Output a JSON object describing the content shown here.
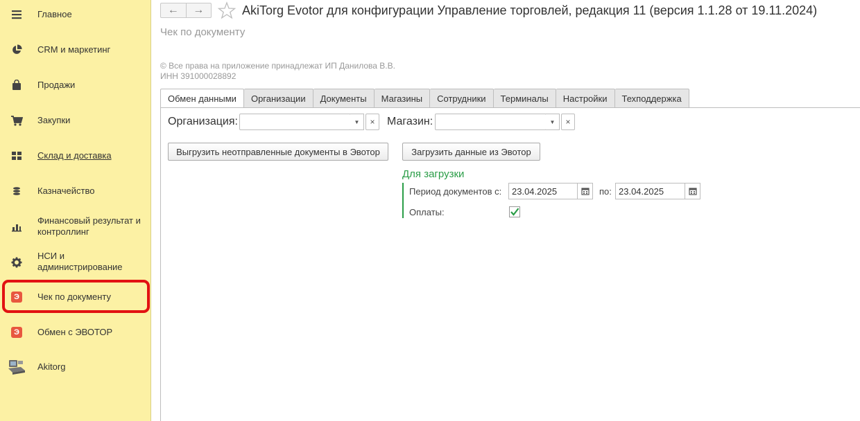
{
  "sidebar": {
    "items": [
      {
        "label": "Главное",
        "icon": "menu-icon"
      },
      {
        "label": "CRM и маркетинг",
        "icon": "pie-chart-icon"
      },
      {
        "label": "Продажи",
        "icon": "shopping-bag-icon"
      },
      {
        "label": "Закупки",
        "icon": "cart-icon"
      },
      {
        "label": "Склад и доставка",
        "icon": "warehouse-icon"
      },
      {
        "label": "Казначейство",
        "icon": "coins-icon"
      },
      {
        "label": "Финансовый результат и контроллинг",
        "icon": "bar-chart-icon"
      },
      {
        "label": "НСИ и администрирование",
        "icon": "gear-icon"
      },
      {
        "label": "Чек по документу",
        "icon": "evotor-icon"
      },
      {
        "label": "Обмен с ЭВОТОР",
        "icon": "evotor-icon"
      },
      {
        "label": "Akitorg",
        "icon": "akitorg-icon"
      }
    ],
    "highlight_color": "#e21212"
  },
  "header": {
    "title": "AkiTorg Evotor для конфигурации Управление торговлей, редакция 11 (версия 1.1.28 от 19.11.2024)",
    "subtitle": "Чек по документу",
    "copyright": "© Все права на приложение принадлежат ИП Данилова В.В.",
    "inn": "ИНН 391000028892"
  },
  "tabs": [
    "Обмен данными",
    "Организации",
    "Документы",
    "Магазины",
    "Сотрудники",
    "Терминалы",
    "Настройки",
    "Техподдержка"
  ],
  "form": {
    "organization_label": "Организация:",
    "organization_value": "",
    "store_label": "Магазин:",
    "store_value": "",
    "upload_button": "Выгрузить неотправленные документы в Эвотор",
    "download_button": "Загрузить данные из Эвотор",
    "group_title": "Для загрузки",
    "period_label": "Период  документов с:",
    "date_from": "23.04.2025",
    "to_label": "по:",
    "date_to": "23.04.2025",
    "payments_label": "Оплаты:",
    "payments_checked": true
  },
  "colors": {
    "sidebar_bg": "#fcf1a4",
    "accent_green": "#2a9d47"
  }
}
